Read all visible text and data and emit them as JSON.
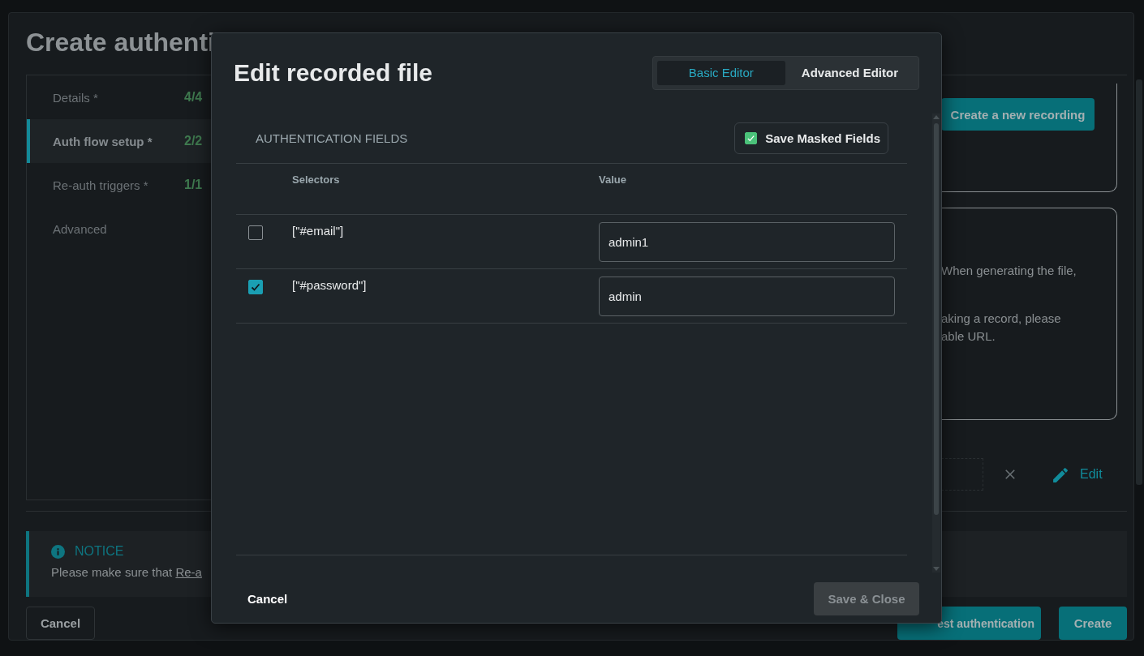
{
  "background_page": {
    "title": "Create authenti",
    "steps": [
      {
        "label": "Details *",
        "count": "4/4",
        "selected": false
      },
      {
        "label": "Auth flow setup *",
        "count": "2/2",
        "selected": true
      },
      {
        "label": "Re-auth triggers *",
        "count": "1/1",
        "selected": false
      },
      {
        "label": "Advanced",
        "selected": false
      }
    ],
    "recording_button": "Create a new recording",
    "info_lines": [
      "When generating the file,",
      "aking a record, please",
      "able URL."
    ],
    "edit_link": "Edit",
    "notice": {
      "title": "NOTICE",
      "text": "Please make sure that ",
      "link": "Re-a"
    },
    "cancel": "Cancel",
    "test": "est authentication",
    "create": "Create"
  },
  "modal": {
    "title": "Edit recorded file",
    "editor_tabs": [
      {
        "label": "Basic Editor",
        "selected": true
      },
      {
        "label": "Advanced Editor",
        "selected": false
      }
    ],
    "section_title": "AUTHENTICATION FIELDS",
    "save_masked_fields": {
      "label": "Save Masked Fields",
      "checked": true
    },
    "columns": [
      "Selectors",
      "Value"
    ],
    "rows": [
      {
        "selector": "[\"#email\"]",
        "checked": false,
        "value": "admin1"
      },
      {
        "selector": "[\"#password\"]",
        "checked": true,
        "value": "admin"
      }
    ],
    "cancel": "Cancel",
    "save": {
      "label": "Save & Close",
      "disabled": true
    }
  }
}
